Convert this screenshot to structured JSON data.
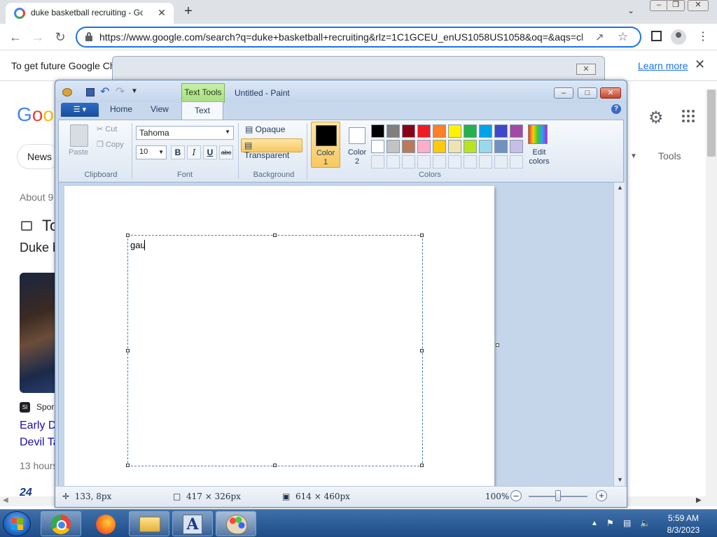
{
  "browser": {
    "tab_title": "duke basketball recruiting - Goog",
    "tab_close": "✕",
    "new_tab": "+",
    "url": "https://www.google.com/search?q=duke+basketball+recruiting&rlz=1C1GCEU_enUS1058US1058&oq=&aqs=chrc",
    "infobar_text": "To get future Google Chro",
    "infobar_link": "Learn more"
  },
  "google": {
    "logo": {
      "g1": "G",
      "o1": "o",
      "o2": "o"
    },
    "chip_news": "News",
    "tools": "Tools",
    "results_count": "About 9",
    "top_stories": "To",
    "heading": "Duke b",
    "source_icon": "SI",
    "source": "Spor",
    "news_title_1": "Early D",
    "news_title_2": "Devil Ta",
    "news_time": "13 hours",
    "logo_247": "24"
  },
  "paint": {
    "title": "Untitled - Paint",
    "text_tools": "Text Tools",
    "tabs": {
      "home": "Home",
      "view": "View",
      "text": "Text"
    },
    "clipboard": {
      "paste": "Paste",
      "cut": "Cut",
      "copy": "Copy",
      "group": "Clipboard"
    },
    "font": {
      "family": "Tahoma",
      "size": "10",
      "bold": "B",
      "italic": "I",
      "underline": "U",
      "strike": "abc",
      "group": "Font"
    },
    "background": {
      "opaque": "Opaque",
      "transparent": "Transparent",
      "group": "Background"
    },
    "colors": {
      "color1_label": "Color\n1",
      "color2_label": "Color\n2",
      "group": "Colors",
      "edit": "Edit\ncolors",
      "color1": "#000000",
      "color2": "#ffffff",
      "row1": [
        "#000000",
        "#7f7f7f",
        "#880015",
        "#ed1c24",
        "#ff7f27",
        "#fff200",
        "#22b14c",
        "#00a2e8",
        "#3f48cc",
        "#a349a4"
      ],
      "row2": [
        "#ffffff",
        "#c3c3c3",
        "#b97a57",
        "#ffaec9",
        "#ffc90e",
        "#efe4b0",
        "#b5e61d",
        "#99d9ea",
        "#7092be",
        "#c8bfe7"
      ]
    },
    "canvas_text": "gau",
    "status": {
      "cursor": "133, 8px",
      "selection": "417 × 326px",
      "size": "614 × 460px",
      "zoom": "100%"
    }
  },
  "taskbar": {
    "fonts_letter": "A",
    "time": "5:59 AM",
    "date": "8/3/2023"
  }
}
